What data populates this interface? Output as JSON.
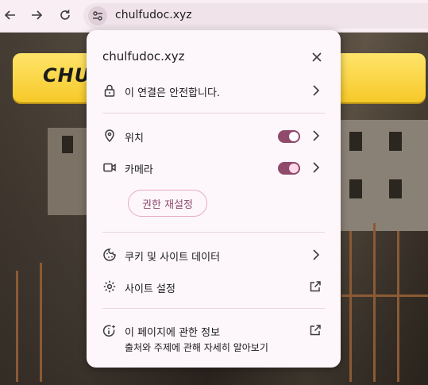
{
  "toolbar": {
    "back_icon": "arrow-left-icon",
    "forward_icon": "arrow-right-icon",
    "reload_icon": "reload-icon",
    "site_info_icon": "tune-icon",
    "url": "chulfudoc.xyz"
  },
  "page": {
    "banner_text": "CHULF"
  },
  "popup": {
    "title": "chulfudoc.xyz",
    "connection": {
      "label": "이 연결은 안전합니다.",
      "icon": "lock-icon"
    },
    "permissions": [
      {
        "label": "위치",
        "icon": "location-pin-icon",
        "enabled": true
      },
      {
        "label": "카메라",
        "icon": "video-camera-icon",
        "enabled": true
      }
    ],
    "reset_label": "권한 재설정",
    "cookies": {
      "label": "쿠키 및 사이트 데이터",
      "icon": "cookie-icon"
    },
    "site_settings": {
      "label": "사이트 설정",
      "icon": "gear-icon"
    },
    "about": {
      "label": "이 페이지에 관한 정보",
      "sublabel": "출처와 주제에 관해 자세히 알아보기",
      "icon": "info-sparkle-icon"
    }
  },
  "colors": {
    "accent": "#8f4a6c",
    "popup_bg": "#fdf7fb",
    "toolbar_bg": "#f8eef3",
    "banner": "#f6c928"
  }
}
